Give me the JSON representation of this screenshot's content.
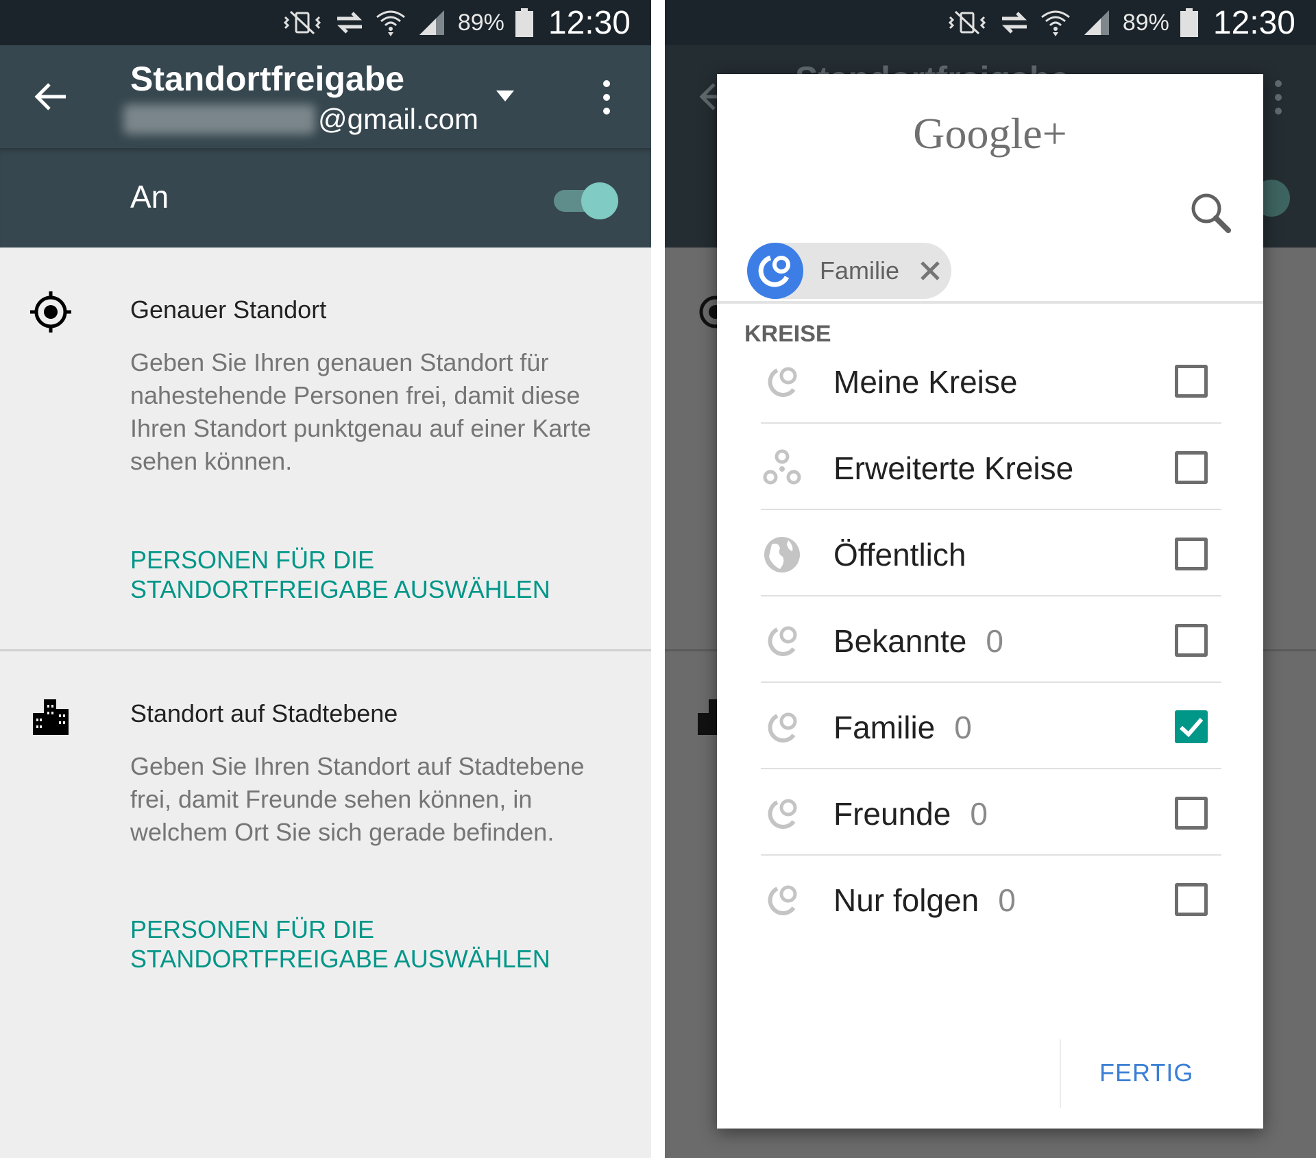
{
  "status_bar": {
    "battery": "89%",
    "time": "12:30"
  },
  "left": {
    "toolbar": {
      "title": "Standortfreigabe",
      "email_suffix": "@gmail.com"
    },
    "switch": {
      "label": "An",
      "on": true
    },
    "sections": [
      {
        "icon": "gps-crosshair-icon",
        "title": "Genauer Standort",
        "description": "Geben Sie Ihren genauen Standort für nahestehende Personen frei, damit diese Ihren Standort punktgenau auf einer Karte sehen können.",
        "link": "PERSONEN FÜR DIE STANDORTFREIGABE AUSWÄHLEN"
      },
      {
        "icon": "city-buildings-icon",
        "title": "Standort auf Stadtebene",
        "description": "Geben Sie Ihren Standort auf Stadtebene frei, damit Freunde sehen können, in welchem Ort Sie sich gerade befinden.",
        "link": "PERSONEN FÜR DIE STANDORTFREIGABE AUSWÄHLEN"
      }
    ]
  },
  "dialog": {
    "logo": "Google+",
    "chip": {
      "label": "Familie"
    },
    "section_header": "KREISE",
    "circles": [
      {
        "label": "Meine Kreise",
        "count": "",
        "icon": "circles-icon",
        "checked": false
      },
      {
        "label": "Erweiterte Kreise",
        "count": "",
        "icon": "extended-circles-icon",
        "checked": false
      },
      {
        "label": "Öffentlich",
        "count": "",
        "icon": "globe-icon",
        "checked": false
      },
      {
        "label": "Bekannte",
        "count": "0",
        "icon": "circles-icon",
        "checked": false
      },
      {
        "label": "Familie",
        "count": "0",
        "icon": "circles-icon",
        "checked": true
      },
      {
        "label": "Freunde",
        "count": "0",
        "icon": "circles-icon",
        "checked": false
      },
      {
        "label": "Nur folgen",
        "count": "0",
        "icon": "circles-icon",
        "checked": false
      }
    ],
    "done_label": "FERTIG"
  },
  "colors": {
    "toolbar": "#37474f",
    "accent_teal": "#009688",
    "dialog_button": "#3a7fd5",
    "chip_avatar": "#3d7ee6"
  }
}
